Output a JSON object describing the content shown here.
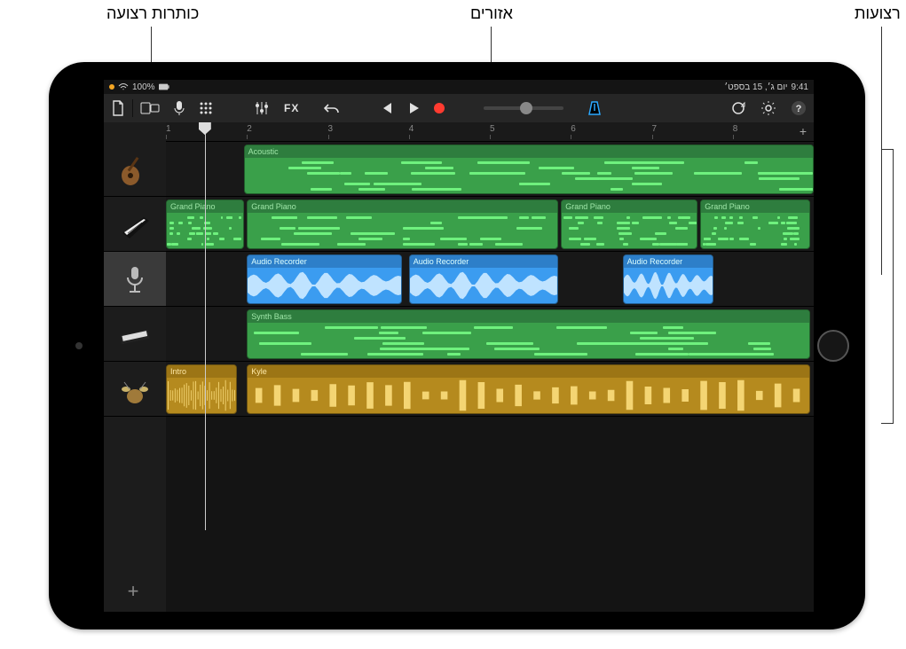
{
  "callouts": {
    "track_headers": "כותרות רצועה",
    "regions": "אזורים",
    "tracks": "רצועות"
  },
  "status": {
    "time": "9:41",
    "date": "יום ג׳, 15 בספט׳",
    "battery": "100%"
  },
  "toolbar": {
    "fx_label": "FX"
  },
  "ruler": {
    "bars": [
      "1",
      "2",
      "3",
      "4",
      "5",
      "6",
      "7",
      "8"
    ],
    "add": "+"
  },
  "tracks": [
    {
      "instrument": "guitar",
      "regions": [
        {
          "label": "Acoustic",
          "kind": "midi-green",
          "start_pct": 12.0,
          "width_pct": 88.0
        }
      ]
    },
    {
      "instrument": "piano",
      "regions": [
        {
          "label": "Grand Piano",
          "kind": "midi-green",
          "start_pct": 0,
          "width_pct": 12.0
        },
        {
          "label": "Grand Piano",
          "kind": "midi-green",
          "start_pct": 12.5,
          "width_pct": 48.0
        },
        {
          "label": "Grand Piano",
          "kind": "midi-green",
          "start_pct": 61.0,
          "width_pct": 21.0
        },
        {
          "label": "Grand Piano",
          "kind": "midi-green",
          "start_pct": 82.5,
          "width_pct": 17.0
        }
      ]
    },
    {
      "instrument": "microphone",
      "selected": true,
      "regions": [
        {
          "label": "Audio Recorder",
          "kind": "audio-blue",
          "start_pct": 12.5,
          "width_pct": 24.0
        },
        {
          "label": "Audio Recorder",
          "kind": "audio-blue",
          "start_pct": 37.5,
          "width_pct": 23.0
        },
        {
          "label": "Audio Recorder",
          "kind": "audio-blue",
          "start_pct": 70.5,
          "width_pct": 14.0
        }
      ]
    },
    {
      "instrument": "keyboard",
      "regions": [
        {
          "label": "Synth Bass",
          "kind": "midi-green",
          "start_pct": 12.5,
          "width_pct": 87.0
        }
      ]
    },
    {
      "instrument": "drums",
      "regions": [
        {
          "label": "Intro",
          "kind": "audio-yellow",
          "start_pct": 0,
          "width_pct": 11.0
        },
        {
          "label": "Kyle",
          "kind": "audio-yellow",
          "start_pct": 12.5,
          "width_pct": 87.0
        }
      ]
    }
  ],
  "playhead_bar_pct": 6.0,
  "add_track": "+"
}
